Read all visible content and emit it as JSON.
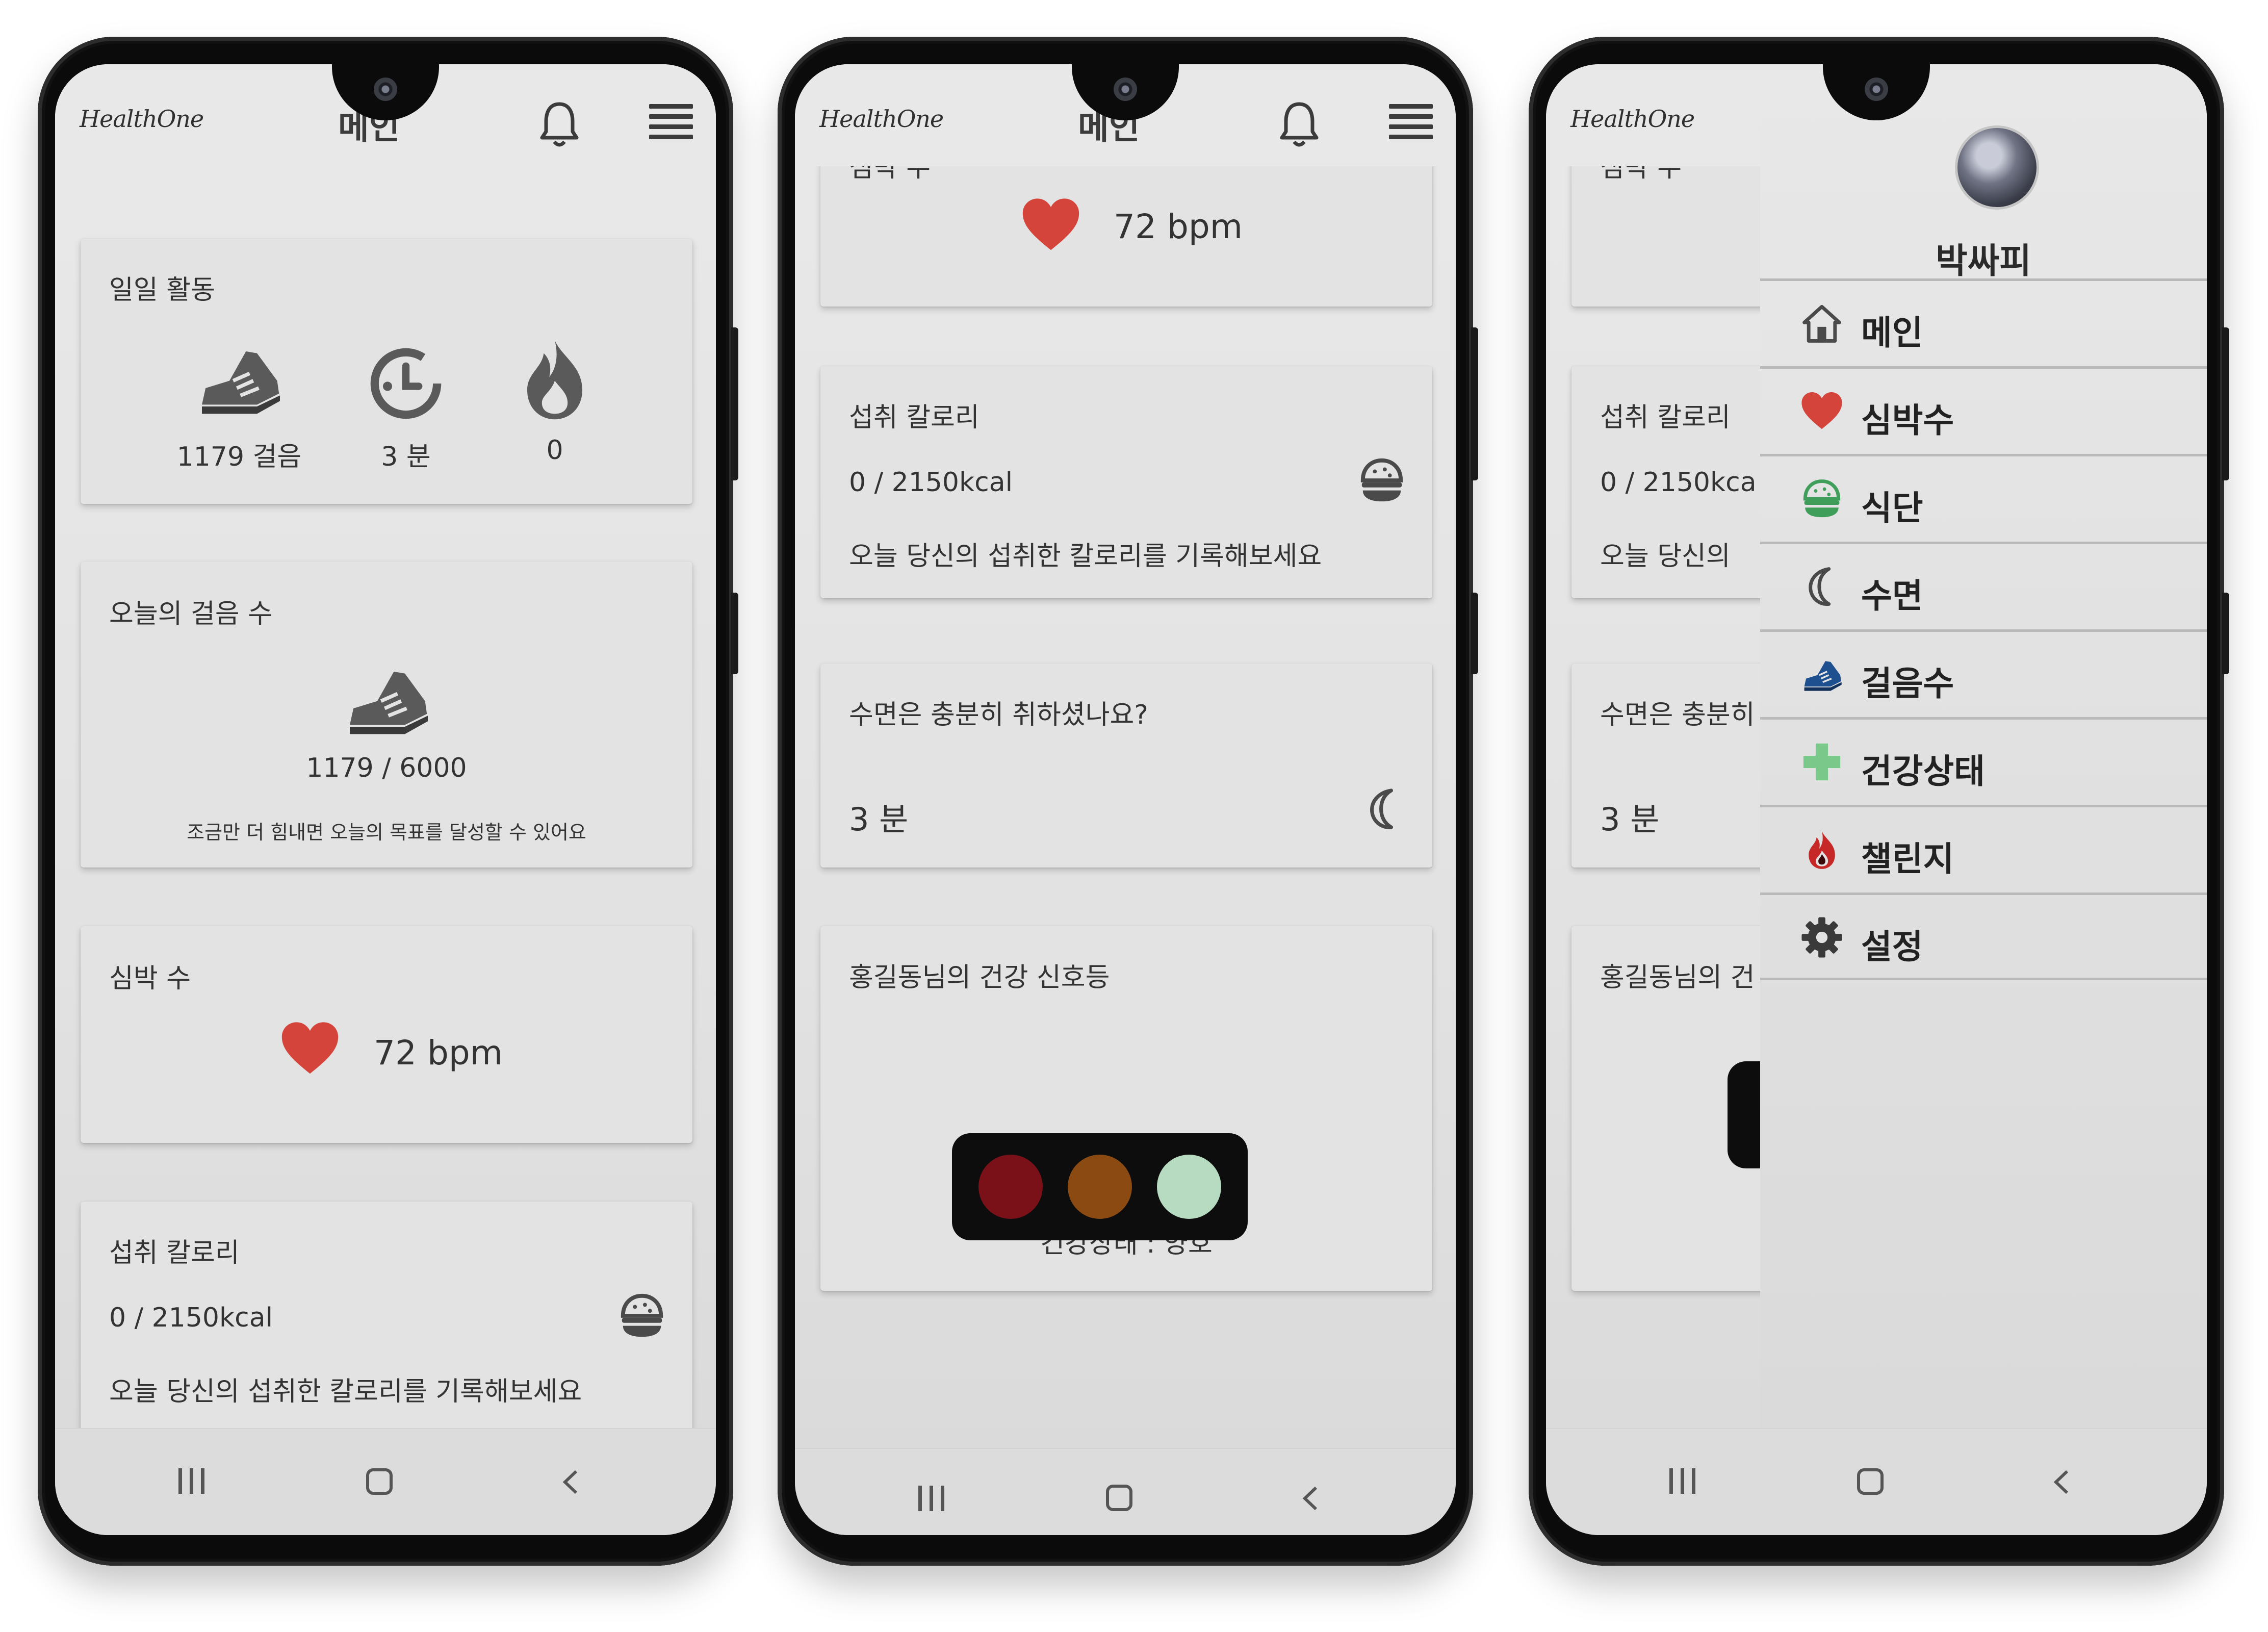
{
  "app": {
    "logo": "HealthOne",
    "title": "메인"
  },
  "screen1": {
    "daily": {
      "title": "일일 활동",
      "steps": "1179 걸음",
      "minutes": "3 분",
      "calories": "0"
    },
    "steps_card": {
      "title": "오늘의 걸음 수",
      "progress": "1179 / 6000",
      "message": "조금만 더 힘내면 오늘의 목표를 달성할 수 있어요"
    },
    "heart": {
      "title": "심박 수",
      "value": "72 bpm"
    },
    "intake": {
      "title": "섭취 칼로리",
      "value": "0 / 2150kcal",
      "message": "오늘 당신의 섭취한 칼로리를 기록해보세요"
    }
  },
  "screen2": {
    "heart": {
      "title": "심박 수",
      "value": "72 bpm"
    },
    "intake": {
      "title": "섭취 칼로리",
      "value": "0 / 2150kcal",
      "message": "오늘 당신의 섭취한 칼로리를 기록해보세요"
    },
    "sleep": {
      "title": "수면은 충분히 취하셨나요?",
      "value": "3 분"
    },
    "signal": {
      "title": "홍길동님의 건강 신호등",
      "status": "건강상태 : 양호",
      "colors": [
        "#7a1118",
        "#8a4a12",
        "#b7dbc0"
      ]
    }
  },
  "screen3": {
    "bg": {
      "heart_title": "심박 수",
      "intake_title": "섭취 칼로리",
      "intake_value": "0 / 2150kca",
      "intake_message": "오늘 당신의",
      "sleep_title": "수면은 충분히",
      "sleep_value": "3 분",
      "signal_title": "홍길동님의 건"
    },
    "drawer": {
      "user_name": "박싸피",
      "items": [
        {
          "label": "메인",
          "icon": "home-icon"
        },
        {
          "label": "심박수",
          "icon": "heart-icon"
        },
        {
          "label": "식단",
          "icon": "burger-icon"
        },
        {
          "label": "수면",
          "icon": "moon-icon"
        },
        {
          "label": "걸음수",
          "icon": "shoe-icon"
        },
        {
          "label": "건강상태",
          "icon": "health-cross-icon"
        },
        {
          "label": "챌린지",
          "icon": "flame-icon"
        },
        {
          "label": "설정",
          "icon": "gear-icon"
        }
      ]
    }
  },
  "colors": {
    "heart": "#d4443a",
    "cross": "#7bc98a",
    "flame_red": "#c62828",
    "shoe_blue": "#1e4f8f"
  }
}
